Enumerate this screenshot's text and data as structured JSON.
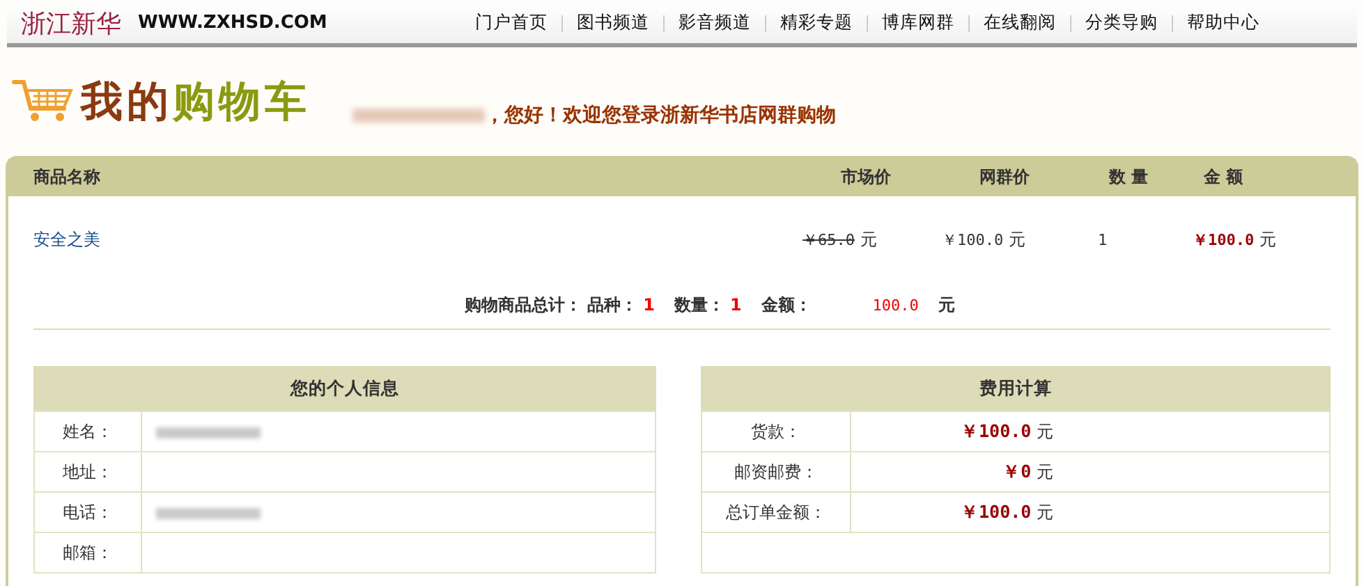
{
  "header": {
    "logo_text": "浙江新华",
    "logo_url": "WWW.ZXHSD.COM",
    "nav": [
      {
        "label": "门户首页"
      },
      {
        "label": "图书频道"
      },
      {
        "label": "影音频道"
      },
      {
        "label": "精彩专题"
      },
      {
        "label": "博库网群"
      },
      {
        "label": "在线翻阅"
      },
      {
        "label": "分类导购"
      },
      {
        "label": "帮助中心"
      }
    ]
  },
  "page_title": {
    "first": "我的",
    "second": "购物车"
  },
  "greeting": {
    "text": "，您好！欢迎您登录浙新华书店网群购物"
  },
  "cart": {
    "columns": [
      "商品名称",
      "市场价",
      "网群价",
      "数 量",
      "金 额"
    ],
    "rows": [
      {
        "name": "安全之美",
        "market_price": "￥65.0",
        "market_unit": "元",
        "price": "￥100.0",
        "price_unit": "元",
        "quantity": "1",
        "amount": "￥100.0",
        "amount_unit": "元"
      }
    ],
    "summary": {
      "label": "购物商品总计：",
      "items": [
        {
          "label": "品种：",
          "value": "1"
        },
        {
          "label": "数量：",
          "value": "1"
        }
      ],
      "amount_label": "金额：",
      "amount": "100.0",
      "unit": "元"
    }
  },
  "personal_info": {
    "title": "您的个人信息",
    "rows": [
      {
        "label": "姓名：",
        "redacted": true
      },
      {
        "label": "地址：",
        "redacted": false
      },
      {
        "label": "电话：",
        "redacted": true
      },
      {
        "label": "邮箱：",
        "redacted": false
      }
    ]
  },
  "fees": {
    "title": "费用计算",
    "rows": [
      {
        "label": "货款：",
        "amount": "￥100.0",
        "unit": "元"
      },
      {
        "label": "邮资邮费：",
        "amount": "￥0",
        "unit": "元"
      },
      {
        "label": "总订单金额：",
        "amount": "￥100.0",
        "unit": "元"
      }
    ]
  }
}
